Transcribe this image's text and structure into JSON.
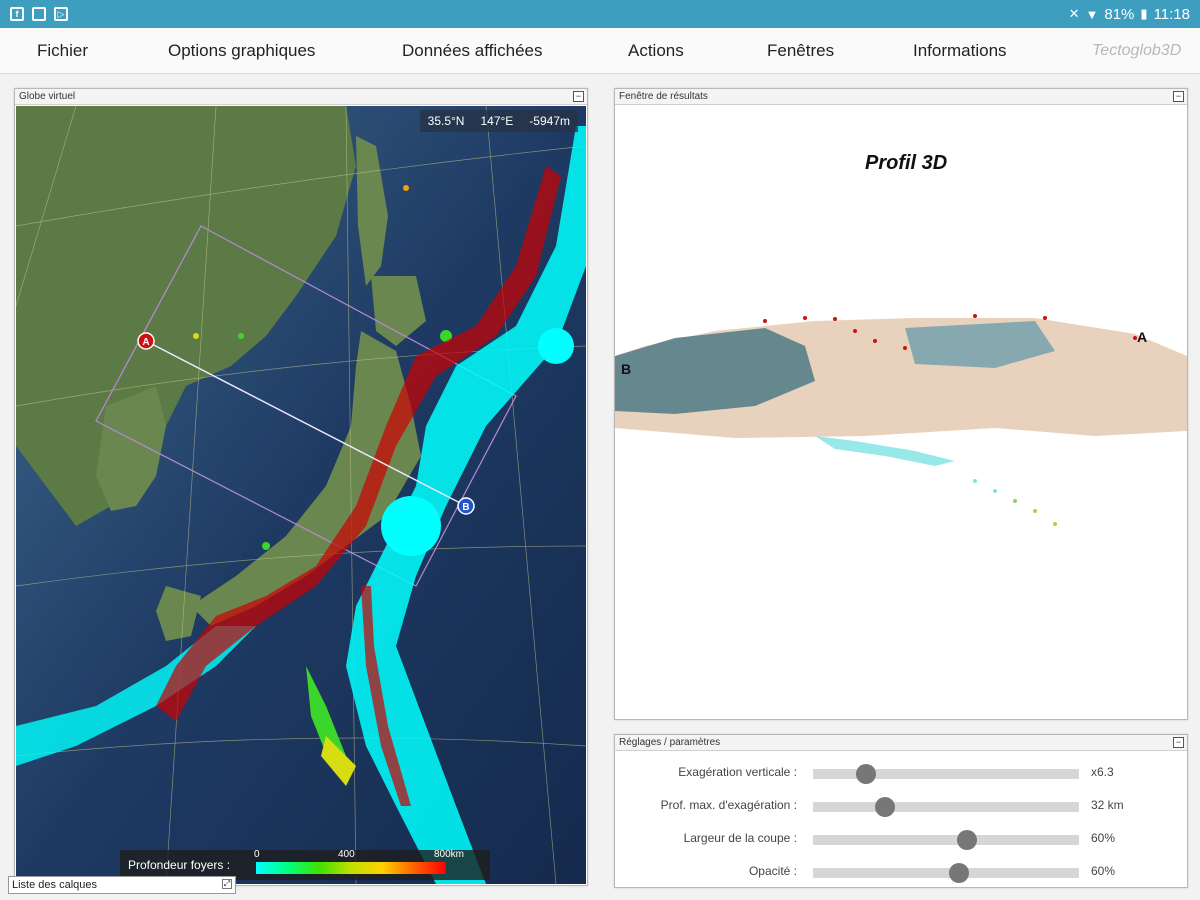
{
  "status_bar": {
    "battery": "81%",
    "time": "11:18"
  },
  "menu": {
    "items": [
      "Fichier",
      "Options graphiques",
      "Données affichées",
      "Actions",
      "Fenêtres",
      "Informations"
    ],
    "brand": "Tectoglob3D"
  },
  "globe_panel": {
    "title": "Globe virtuel",
    "coords": {
      "lat": "35.5°N",
      "lon": "147°E",
      "alt": "-5947m"
    },
    "point_a": "A",
    "point_b": "B",
    "depth_legend": {
      "label": "Profondeur foyers :",
      "ticks": [
        "0",
        "400",
        "800km"
      ]
    }
  },
  "layers": {
    "label": "Liste des calques"
  },
  "results_panel": {
    "title": "Fenêtre de résultats",
    "profile_title": "Profil 3D",
    "label_a": "A",
    "label_b": "B"
  },
  "settings_panel": {
    "title": "Réglages / paramètres",
    "rows": [
      {
        "label": "Exagération verticale :",
        "value": "x6.3",
        "level": 0.2
      },
      {
        "label": "Prof. max. d'exagération :",
        "value": "32 km",
        "level": 0.27
      },
      {
        "label": "Largeur de la coupe :",
        "value": "60%",
        "level": 0.58
      },
      {
        "label": "Opacité :",
        "value": "60%",
        "level": 0.55
      }
    ]
  },
  "colors": {
    "status_bar": "#3e9ec0",
    "quake_shallow": "#00ffff",
    "volcano": "#cc0000",
    "point_a": "#cc1111",
    "point_b": "#2255cc"
  }
}
